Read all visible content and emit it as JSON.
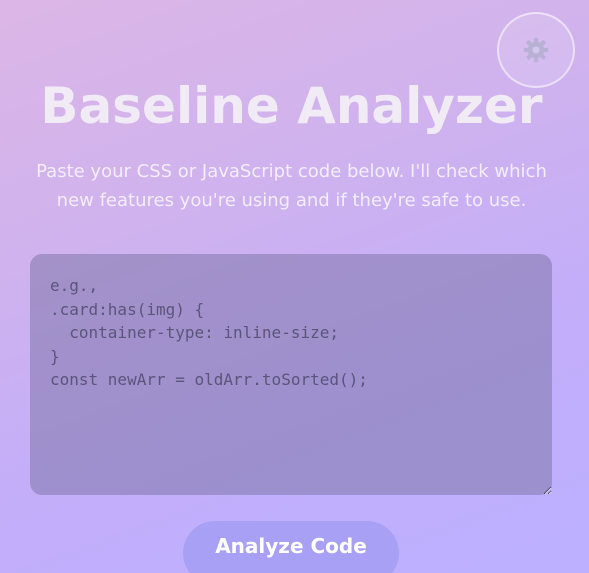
{
  "header": {
    "title": "Baseline Analyzer",
    "subtitle": "Paste your CSS or JavaScript code below. I'll check which new features you're using and if they're safe to use."
  },
  "settings": {
    "icon": "gear-icon"
  },
  "editor": {
    "value": "",
    "placeholder": "e.g.,\n.card:has(img) {\n  container-type: inline-size;\n}\nconst newArr = oldArr.toSorted();"
  },
  "actions": {
    "analyze_label": "Analyze Code"
  },
  "colors": {
    "accent": "#a8a0f5",
    "title": "#f1ebf6",
    "editor_bg": "#9a90c8"
  }
}
